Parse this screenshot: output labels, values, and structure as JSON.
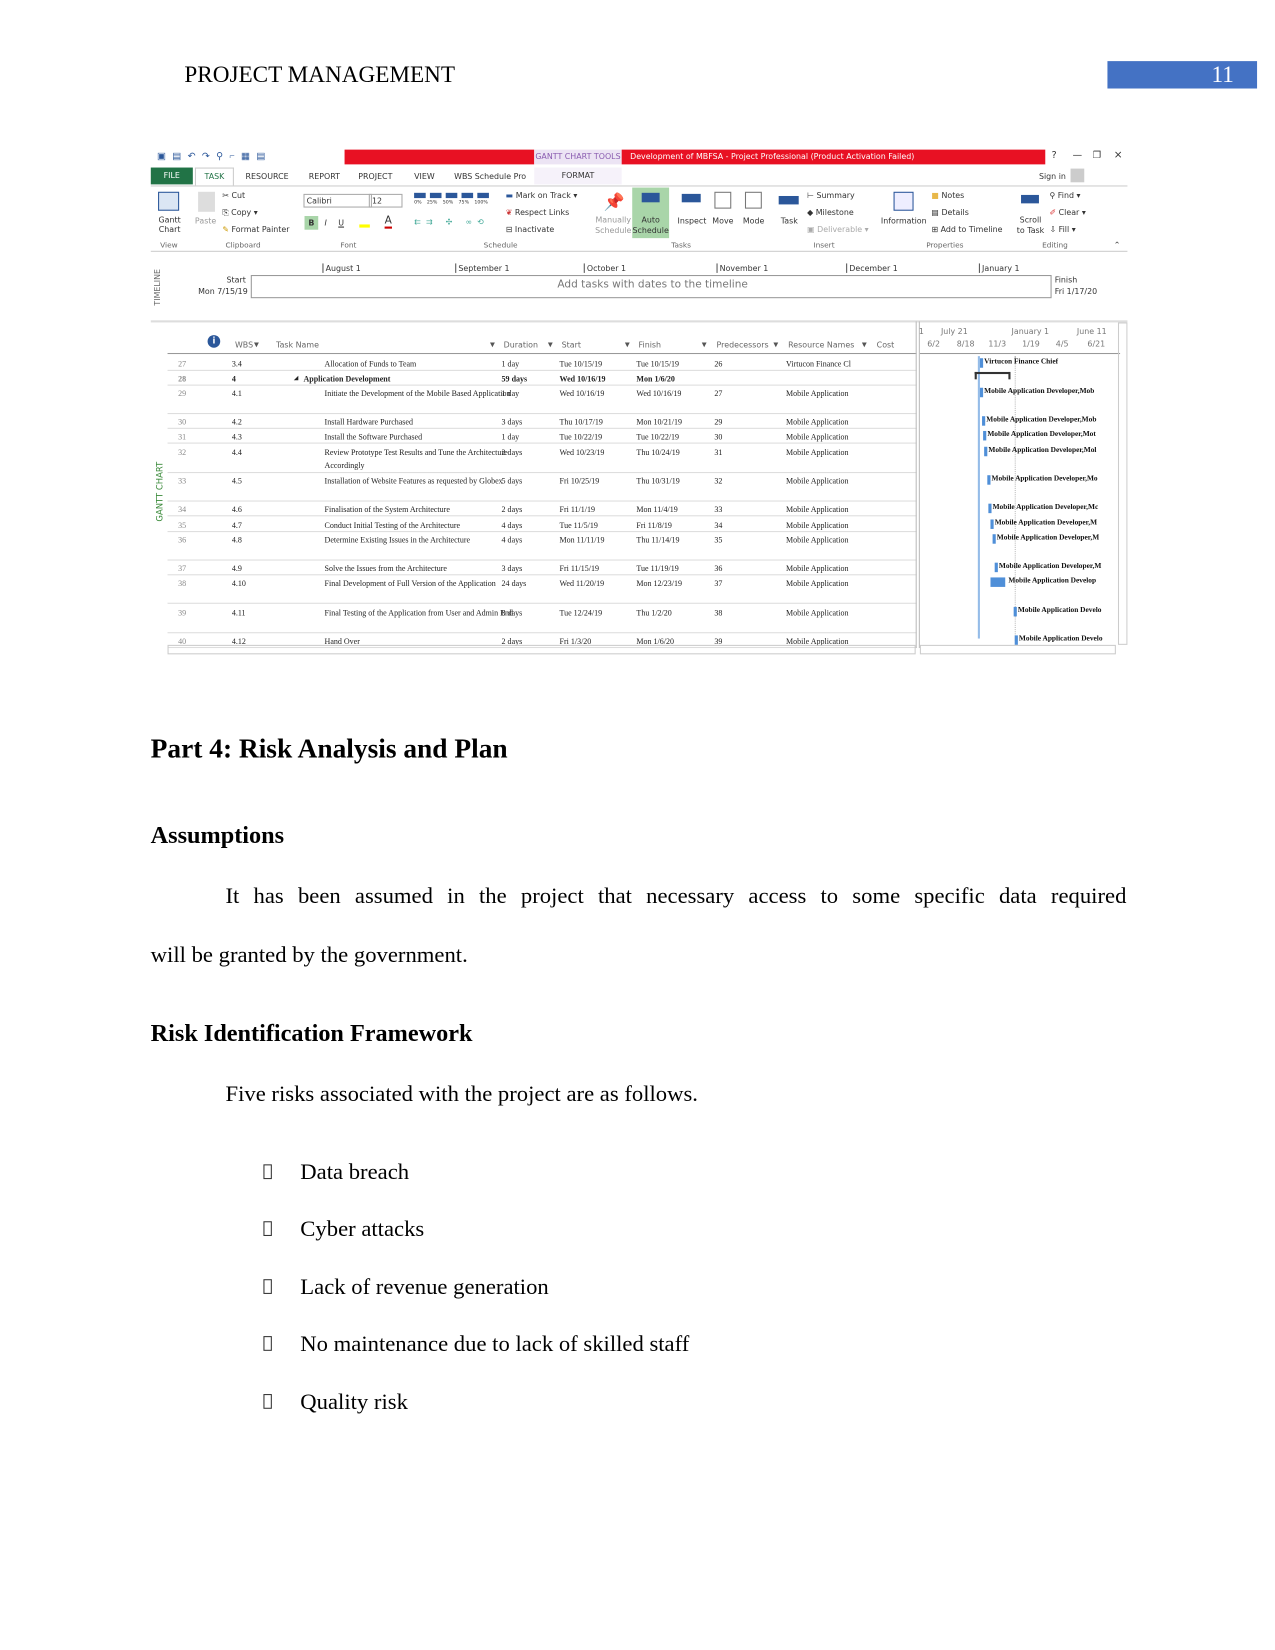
{
  "header": {
    "title": "PROJECT MANAGEMENT",
    "page_number": "11"
  },
  "app": {
    "window_title": "Development of MBFSA -  Project Professional (Product Activation Failed)",
    "context_tab": "GANTT CHART TOOLS",
    "window_controls": [
      "?",
      "—",
      "❐",
      "×"
    ],
    "tabs": [
      "FILE",
      "TASK",
      "RESOURCE",
      "REPORT",
      "PROJECT",
      "VIEW",
      "WBS Schedule Pro",
      "FORMAT"
    ],
    "selected_tab": "TASK",
    "sign_in": "Sign in",
    "ribbon": {
      "view": {
        "button": "Gantt Chart",
        "group": "View"
      },
      "clipboard": {
        "paste": "Paste",
        "cut": "Cut",
        "copy": "Copy",
        "format_painter": "Format Painter",
        "group": "Clipboard"
      },
      "font": {
        "font_name": "Calibri",
        "font_size": "12",
        "bold": "B",
        "italic": "I",
        "underline": "U",
        "group": "Font"
      },
      "schedule": {
        "percent": [
          "0%",
          "25%",
          "50%",
          "75%",
          "100%"
        ],
        "mark_on_track": "Mark on Track",
        "respect_links": "Respect Links",
        "inactivate": "Inactivate",
        "group": "Schedule"
      },
      "tasks": {
        "manually": "Manually Schedule",
        "auto": "Auto Schedule",
        "inspect": "Inspect",
        "move": "Move",
        "mode": "Mode",
        "group": "Tasks"
      },
      "insert": {
        "task": "Task",
        "summary": "Summary",
        "milestone": "Milestone",
        "deliverable": "Deliverable",
        "group": "Insert"
      },
      "properties": {
        "information": "Information",
        "notes": "Notes",
        "details": "Details",
        "add_to_timeline": "Add to Timeline",
        "group": "Properties"
      },
      "editing": {
        "scroll": "Scroll to Task",
        "find": "Find",
        "clear": "Clear",
        "fill": "Fill",
        "group": "Editing"
      }
    },
    "timeline": {
      "label": "TIMELINE",
      "start_label": "Start",
      "start_date": "Mon 7/15/19",
      "finish_label": "Finish",
      "finish_date": "Fri 1/17/20",
      "placeholder": "Add tasks with dates to the timeline",
      "months": [
        "August 1",
        "September 1",
        "October 1",
        "November 1",
        "December 1",
        "January 1"
      ]
    },
    "gantt_label": "GANTT CHART",
    "columns": [
      "WBS",
      "Task Name",
      "Duration",
      "Start",
      "Finish",
      "Predecessors",
      "Resource Names",
      "Cost"
    ],
    "rows": [
      {
        "id": "27",
        "wbs": "3.4",
        "name": "Allocation of Funds to Team",
        "duration": "1 day",
        "start": "Tue 10/15/19",
        "finish": "Tue 10/15/19",
        "pred": "26",
        "res": "Virtucon Finance Cl",
        "bar": "Virtucon Finance Chief"
      },
      {
        "id": "28",
        "wbs": "4",
        "name": "Application Development",
        "duration": "59 days",
        "start": "Wed 10/16/19",
        "finish": "Mon 1/6/20",
        "pred": "",
        "res": "",
        "bar": "",
        "summary": true
      },
      {
        "id": "29",
        "wbs": "4.1",
        "name": "Initiate the Development of the Mobile Based Application",
        "duration": "1 day",
        "start": "Wed 10/16/19",
        "finish": "Wed 10/16/19",
        "pred": "27",
        "res": "Mobile Application",
        "bar": "Mobile Application Developer,Mob"
      },
      {
        "id": "30",
        "wbs": "4.2",
        "name": "Install Hardware Purchased",
        "duration": "3 days",
        "start": "Thu 10/17/19",
        "finish": "Mon 10/21/19",
        "pred": "29",
        "res": "Mobile Application",
        "bar": "Mobile Application Developer,Mob"
      },
      {
        "id": "31",
        "wbs": "4.3",
        "name": "Install the Software Purchased",
        "duration": "1 day",
        "start": "Tue 10/22/19",
        "finish": "Tue 10/22/19",
        "pred": "30",
        "res": "Mobile Application",
        "bar": "Mobile Application Developer,Mot"
      },
      {
        "id": "32",
        "wbs": "4.4",
        "name": "Review Prototype Test Results and Tune the Architecture Accordingly",
        "duration": "2 days",
        "start": "Wed 10/23/19",
        "finish": "Thu 10/24/19",
        "pred": "31",
        "res": "Mobile Application",
        "bar": "Mobile Application Developer,Mol"
      },
      {
        "id": "33",
        "wbs": "4.5",
        "name": "Installation of Website Features as requested by Globex",
        "duration": "5 days",
        "start": "Fri 10/25/19",
        "finish": "Thu 10/31/19",
        "pred": "32",
        "res": "Mobile Application",
        "bar": "Mobile Application Developer,Mo"
      },
      {
        "id": "34",
        "wbs": "4.6",
        "name": "Finalisation of the System Architecture",
        "duration": "2 days",
        "start": "Fri 11/1/19",
        "finish": "Mon 11/4/19",
        "pred": "33",
        "res": "Mobile Application",
        "bar": "Mobile Application Developer,Mc"
      },
      {
        "id": "35",
        "wbs": "4.7",
        "name": "Conduct Initial Testing of the Architecture",
        "duration": "4 days",
        "start": "Tue 11/5/19",
        "finish": "Fri 11/8/19",
        "pred": "34",
        "res": "Mobile Application",
        "bar": "Mobile Application Developer,M"
      },
      {
        "id": "36",
        "wbs": "4.8",
        "name": "Determine Existing Issues in the Architecture",
        "duration": "4 days",
        "start": "Mon 11/11/19",
        "finish": "Thu 11/14/19",
        "pred": "35",
        "res": "Mobile Application",
        "bar": "Mobile Application Developer,M"
      },
      {
        "id": "37",
        "wbs": "4.9",
        "name": "Solve the Issues from the Architecture",
        "duration": "3 days",
        "start": "Fri 11/15/19",
        "finish": "Tue 11/19/19",
        "pred": "36",
        "res": "Mobile Application",
        "bar": "Mobile Application Developer,M"
      },
      {
        "id": "38",
        "wbs": "4.10",
        "name": "Final Development of Full Version of the Application",
        "duration": "24 days",
        "start": "Wed 11/20/19",
        "finish": "Mon 12/23/19",
        "pred": "37",
        "res": "Mobile Application",
        "bar": "Mobile Application Develop"
      },
      {
        "id": "39",
        "wbs": "4.11",
        "name": "Final Testing of the Application from User and Admin End",
        "duration": "8 days",
        "start": "Tue 12/24/19",
        "finish": "Thu 1/2/20",
        "pred": "38",
        "res": "Mobile Application",
        "bar": "Mobile Application Develo"
      },
      {
        "id": "40",
        "wbs": "4.12",
        "name": "Hand Over",
        "duration": "2 days",
        "start": "Fri 1/3/20",
        "finish": "Mon 1/6/20",
        "pred": "39",
        "res": "Mobile Application",
        "bar": "Mobile Application Develo"
      }
    ],
    "gantt_top": [
      "1",
      "July 21",
      "January 1",
      "June 11"
    ],
    "gantt_bottom": [
      "6/2",
      "8/18",
      "11/3",
      "1/19",
      "4/5",
      "6/21"
    ],
    "colors": {
      "title_bar": "#e81123",
      "file_tab": "#217346",
      "bar": "#4f8fd8"
    }
  },
  "doc": {
    "part_title": "Part 4: Risk Analysis and Plan",
    "assumptions_title": "Assumptions",
    "assumptions_line1": "It has been assumed in the project that necessary access to some specific data required",
    "assumptions_line2": "will be granted by the government.",
    "risk_title": "Risk Identification Framework",
    "risk_intro": "Five risks associated with the project are as follows.",
    "risks": [
      "Data breach",
      "Cyber attacks",
      "Lack of revenue generation",
      "No maintenance due to lack of skilled staff",
      "Quality risk"
    ]
  }
}
